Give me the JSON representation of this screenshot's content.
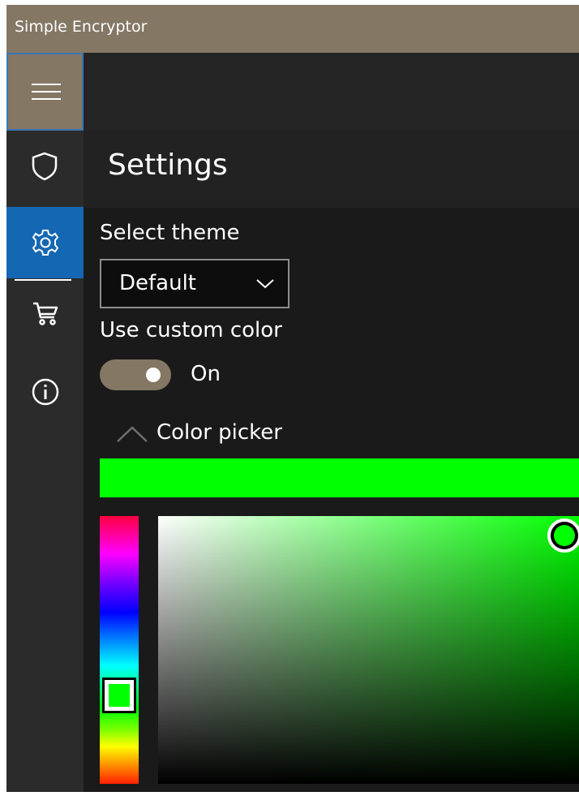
{
  "window": {
    "title": "Simple Encryptor"
  },
  "sidebar": {
    "items": [
      {
        "name": "encrypt",
        "icon": "shield-icon",
        "selected": false
      },
      {
        "name": "settings",
        "icon": "gear-icon",
        "selected": true
      },
      {
        "name": "store",
        "icon": "cart-icon",
        "selected": false
      },
      {
        "name": "about",
        "icon": "info-icon",
        "selected": false
      }
    ]
  },
  "page": {
    "title": "Settings"
  },
  "settings": {
    "theme_label": "Select theme",
    "theme_value": "Default",
    "custom_color_label": "Use custom color",
    "toggle_state": "On",
    "toggle_on": true,
    "color_picker_label": "Color picker",
    "selected_color": "#00ff00",
    "hue_position": 0.67,
    "saturation": 1.0,
    "value": 1.0
  },
  "colors": {
    "accent": "#847764",
    "selection": "#1467b3",
    "background": "#1a1a1a"
  }
}
